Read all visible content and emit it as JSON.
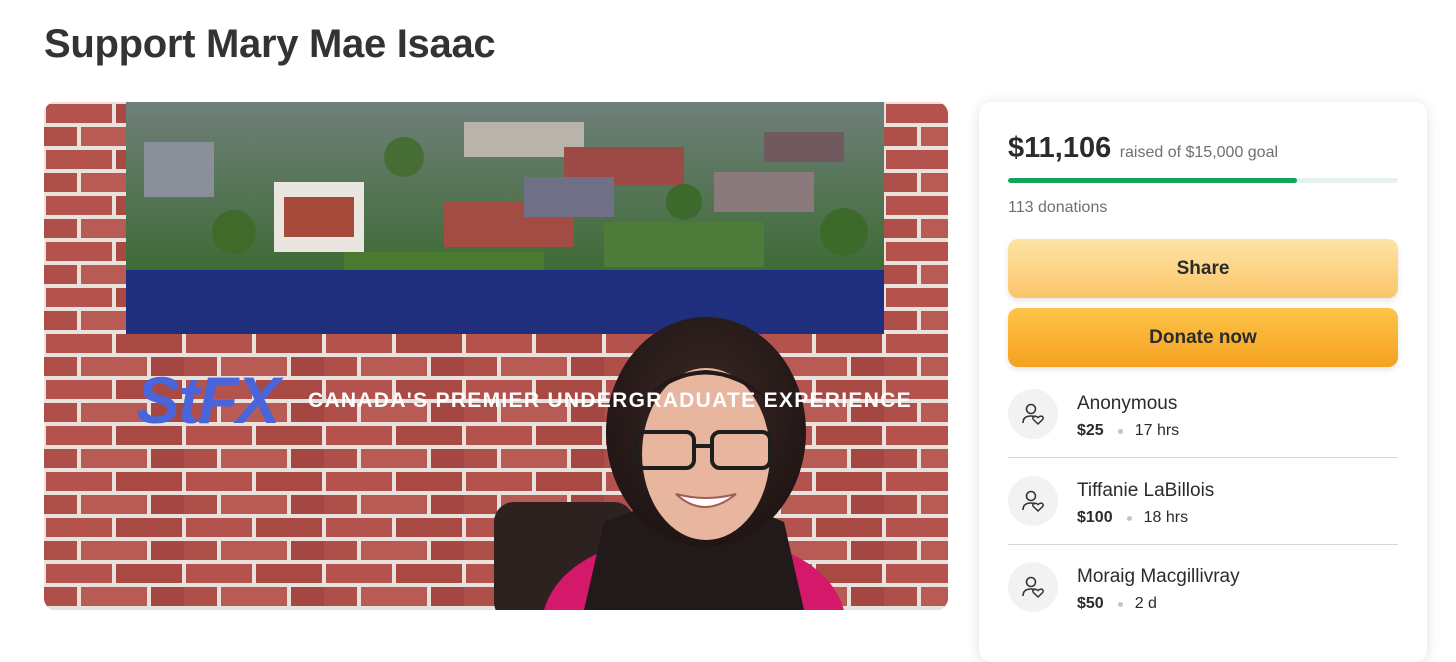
{
  "page": {
    "title": "Support Mary Mae Isaac"
  },
  "hero": {
    "banner_text": "CANADA'S PREMIER UNDERGRADUATE EXPERIENCE",
    "banner_logo": "StFX"
  },
  "fundraiser": {
    "raised": "$11,106",
    "goal_text": "raised of $15,000 goal",
    "progress_fraction": 0.7404,
    "donations_text": "113 donations",
    "share_label": "Share",
    "donate_label": "Donate now",
    "colors": {
      "progress": "#14a35b",
      "progress_track": "#e5f2ea",
      "donate": "#f7ab2a",
      "share": "#fcd487"
    }
  },
  "donors": [
    {
      "name": "Anonymous",
      "amount": "$25",
      "time": "17 hrs",
      "icon": "donor-heart-icon"
    },
    {
      "name": "Tiffanie LaBillois",
      "amount": "$100",
      "time": "18 hrs",
      "icon": "donor-heart-icon"
    },
    {
      "name": "Moraig Macgillivray",
      "amount": "$50",
      "time": "2 d",
      "icon": "donor-heart-icon"
    }
  ]
}
